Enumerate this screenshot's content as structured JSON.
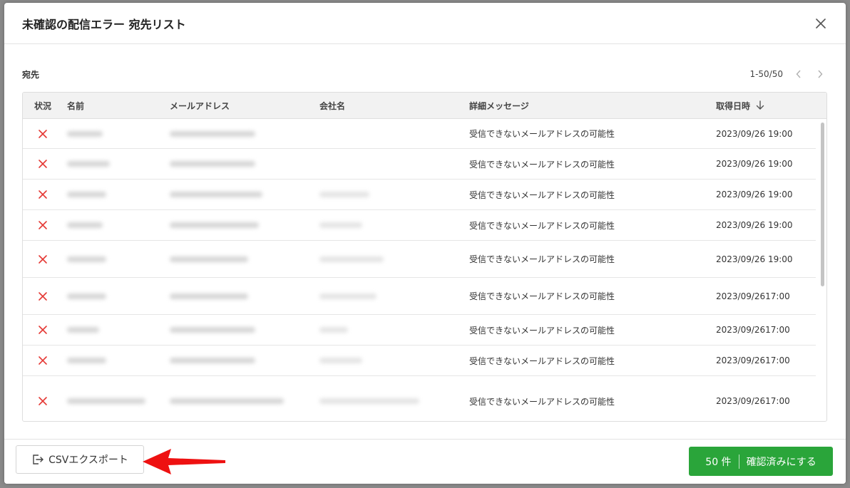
{
  "modal": {
    "title": "未確認の配信エラー 宛先リスト"
  },
  "section": {
    "label": "宛先"
  },
  "pager": {
    "range": "1-50/50"
  },
  "table": {
    "headers": {
      "status": "状況",
      "name": "名前",
      "email": "メールアドレス",
      "company": "会社名",
      "detail": "詳細メッセージ",
      "date": "取得日時"
    },
    "sort_icon": "arrow-down-icon",
    "status_icon": "x-icon",
    "rows": [
      {
        "detail": "受信できないメールアドレスの可能性",
        "date": "2023/09/26 19:00"
      },
      {
        "detail": "受信できないメールアドレスの可能性",
        "date": "2023/09/26 19:00"
      },
      {
        "detail": "受信できないメールアドレスの可能性",
        "date": "2023/09/26 19:00"
      },
      {
        "detail": "受信できないメールアドレスの可能性",
        "date": "2023/09/26 19:00"
      },
      {
        "detail": "受信できないメールアドレスの可能性",
        "date": "2023/09/26 19:00"
      },
      {
        "detail": "受信できないメールアドレスの可能性",
        "date": "2023/09/2617:00"
      },
      {
        "detail": "受信できないメールアドレスの可能性",
        "date": "2023/09/2617:00"
      },
      {
        "detail": "受信できないメールアドレスの可能性",
        "date": "2023/09/2617:00"
      },
      {
        "detail": "受信できないメールアドレスの可能性",
        "date": "2023/09/2617:00"
      }
    ]
  },
  "footer": {
    "csv_label": "CSVエクスポート",
    "count_label": "50 件",
    "confirm_label": "確認済みにする"
  },
  "colors": {
    "accent_green": "#2aa53a",
    "error_red": "#e53935",
    "annotation_red": "#ee1111"
  }
}
